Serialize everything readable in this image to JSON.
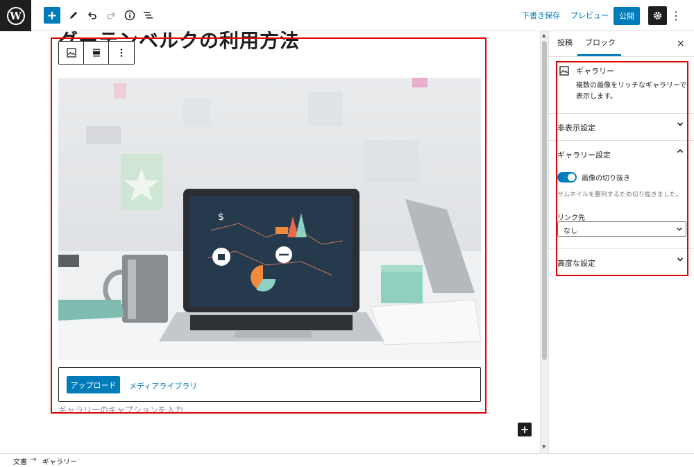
{
  "header": {
    "wp_logo": "W",
    "add_label": "+",
    "save_draft": "下書き保存",
    "preview": "プレビュー",
    "publish": "公開",
    "more": "⋮"
  },
  "editor": {
    "post_title": "グーテンベルクの利用方法",
    "upload_button": "アップロード",
    "media_library": "メディアライブラリ",
    "caption_placeholder": "ギャラリーのキャプションを入力…",
    "inserter_label": "+"
  },
  "sidebar": {
    "tabs": [
      {
        "label": "投稿"
      },
      {
        "label": "ブロック"
      }
    ],
    "active_tab": 1,
    "close_label": "×",
    "block": {
      "title": "ギャラリー",
      "description": "複数の画像をリッチなギャラリーで表示します。"
    },
    "panels": {
      "visibility": {
        "title": "非表示設定",
        "expanded": false
      },
      "gallery_settings": {
        "title": "ギャラリー設定",
        "expanded": true,
        "crop_toggle_label": "画像の切り抜き",
        "crop_toggle_on": true,
        "crop_help": "サムネイルを整列するため切り抜きました。",
        "link_label": "リンク先",
        "link_value": "なし"
      },
      "advanced": {
        "title": "高度な設定",
        "expanded": false
      }
    }
  },
  "footer": {
    "breadcrumb": [
      "文書",
      "ギャラリー"
    ],
    "separator": "→"
  },
  "colors": {
    "accent": "#007cba",
    "dark": "#1e1e1e",
    "highlight": "#e00000"
  }
}
